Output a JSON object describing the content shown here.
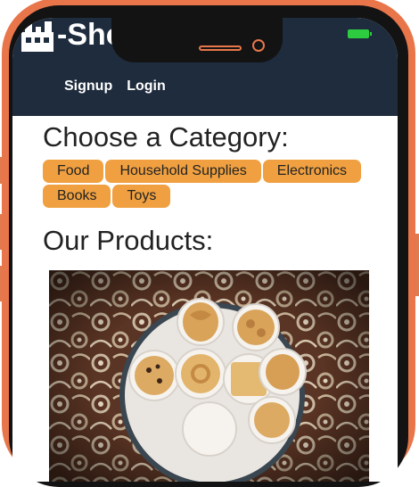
{
  "app": {
    "brand": "-Shop Shop"
  },
  "nav": {
    "signup": "Signup",
    "login": "Login"
  },
  "categories_section": {
    "title": "Choose a Category:",
    "items": [
      "Food",
      "Household Supplies",
      "Electronics",
      "Books",
      "Toys"
    ]
  },
  "products_section": {
    "title": "Our Products:"
  },
  "colors": {
    "header": "#1e2c3d",
    "chip": "#f0a040",
    "frame": "#e8764a"
  }
}
